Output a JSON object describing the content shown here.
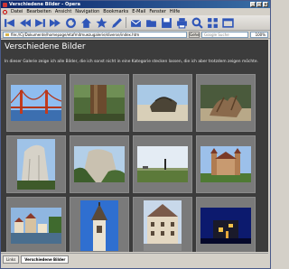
{
  "window": {
    "title": "Verschiedene Bilder - Opera"
  },
  "menu": [
    "Datei",
    "Bearbeiten",
    "Ansicht",
    "Navigation",
    "Bookmarks",
    "E-Mail",
    "Fenster",
    "Hilfe"
  ],
  "address": {
    "url": "file://C|/Dokumente/homepage/etafmitmuezugalerie/diverse/index.htm",
    "go_label": "Gehe",
    "search_placeholder": "Google Suche",
    "zoom": "100%"
  },
  "page": {
    "title": "Verschiedene Bilder",
    "description": "In dieser Galerie zeige ich alle Bilder, die ich sonst nicht in eine Kategorie stecken lassen, die ich aber trotzdem zeigen möchte."
  },
  "tabs": [
    "Links",
    "Verschiedene Bilder"
  ],
  "colors": {
    "page_bg": "#3c3c3c",
    "cell_bg": "#7a7a7a",
    "title_blue": "#0a246a"
  },
  "photos": [
    "golden-gate-bridge",
    "redwood-tree",
    "tree-stump-beach",
    "driftwood-root",
    "half-dome-granite",
    "yosemite-cliff",
    "lighthouse-field",
    "castle-on-hill",
    "riverside-town",
    "church-tower",
    "old-town-hall",
    "house-at-night"
  ]
}
